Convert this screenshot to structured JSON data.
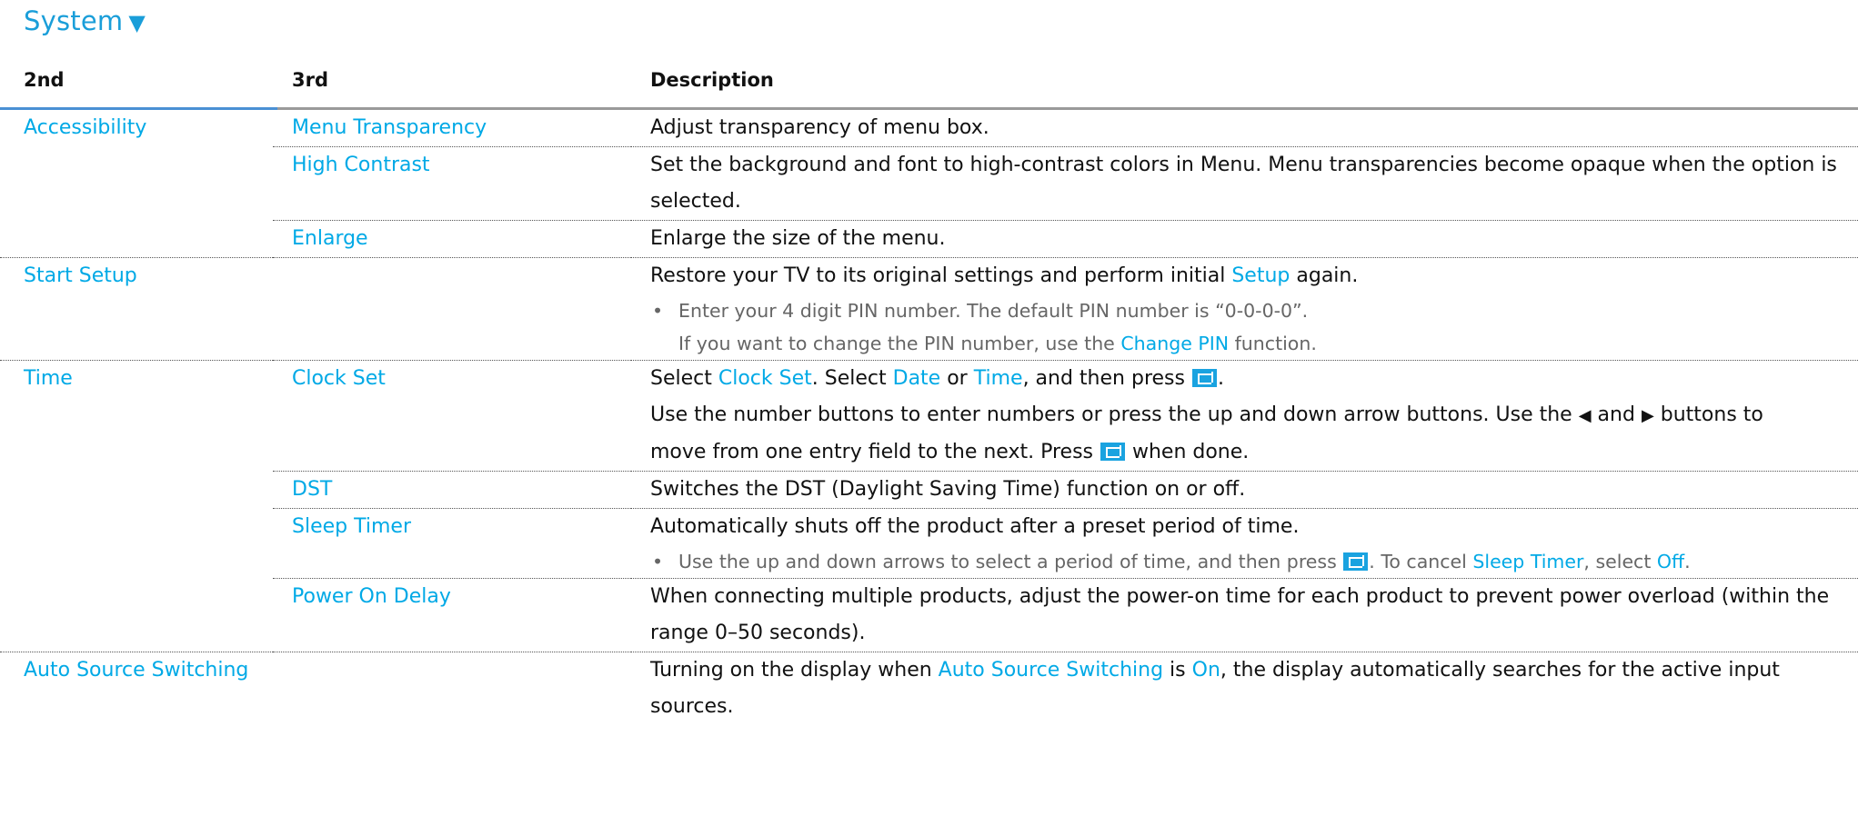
{
  "title": "System",
  "title_icon": "down-triangle-icon",
  "headers": {
    "col2": "2nd",
    "col3": "3rd",
    "desc": "Description"
  },
  "colors": {
    "link": "#00a9e6",
    "title": "#1a9ed9",
    "header_rule_blue": "#4a90d4"
  },
  "rows": {
    "accessibility": {
      "second": "Accessibility",
      "menu_transparency": {
        "third": "Menu Transparency",
        "desc": "Adjust transparency of menu box."
      },
      "high_contrast": {
        "third": "High Contrast",
        "desc": "Set the background and font to high-contrast colors in Menu. Menu transparencies become opaque when the option is selected."
      },
      "enlarge": {
        "third": "Enlarge",
        "desc": "Enlarge the size of the menu."
      }
    },
    "start_setup": {
      "second": "Start Setup",
      "desc_a": "Restore your TV to its original settings and perform initial ",
      "desc_link": "Setup",
      "desc_b": " again.",
      "bullet1": "Enter your 4 digit PIN number. The default PIN number is “0-0-0-0”.",
      "bullet2_a": "If you want to change the PIN number, use the ",
      "bullet2_link": "Change PIN",
      "bullet2_b": " function."
    },
    "time": {
      "second": "Time",
      "clock_set": {
        "third": "Clock Set",
        "l1_a": "Select ",
        "l1_link1": "Clock Set",
        "l1_b": ". Select ",
        "l1_link2": "Date",
        "l1_c": " or ",
        "l1_link3": "Time",
        "l1_d": ", and then press ",
        "l1_e": ".",
        "l2_a": "Use the number buttons to enter numbers or press the up and down arrow buttons. Use the ",
        "left_arrow": "◀",
        "l2_and": " and ",
        "right_arrow": "▶",
        "l2_b": " buttons to",
        "l3_a": "move from one entry field to the next. Press ",
        "l3_b": " when done."
      },
      "dst": {
        "third": "DST",
        "desc": "Switches the DST (Daylight Saving Time) function on or off."
      },
      "sleep_timer": {
        "third": "Sleep Timer",
        "desc": "Automatically shuts off the product after a preset period of time.",
        "bullet_a": "Use the up and down arrows to select a period of time, and then press ",
        "bullet_b": ". To cancel ",
        "bullet_link1": "Sleep Timer",
        "bullet_c": ", select ",
        "bullet_link2": "Off",
        "bullet_d": "."
      },
      "power_on_delay": {
        "third": "Power On Delay",
        "desc": "When connecting multiple products, adjust the power-on time for each product to prevent power overload (within the range 0–50 seconds)."
      }
    },
    "auto_source": {
      "second": "Auto Source Switching",
      "desc_a": "Turning on the display when ",
      "desc_link1": "Auto Source Switching",
      "desc_b": " is ",
      "desc_link2": "On",
      "desc_c": ", the display automatically searches for the active input sources."
    }
  }
}
